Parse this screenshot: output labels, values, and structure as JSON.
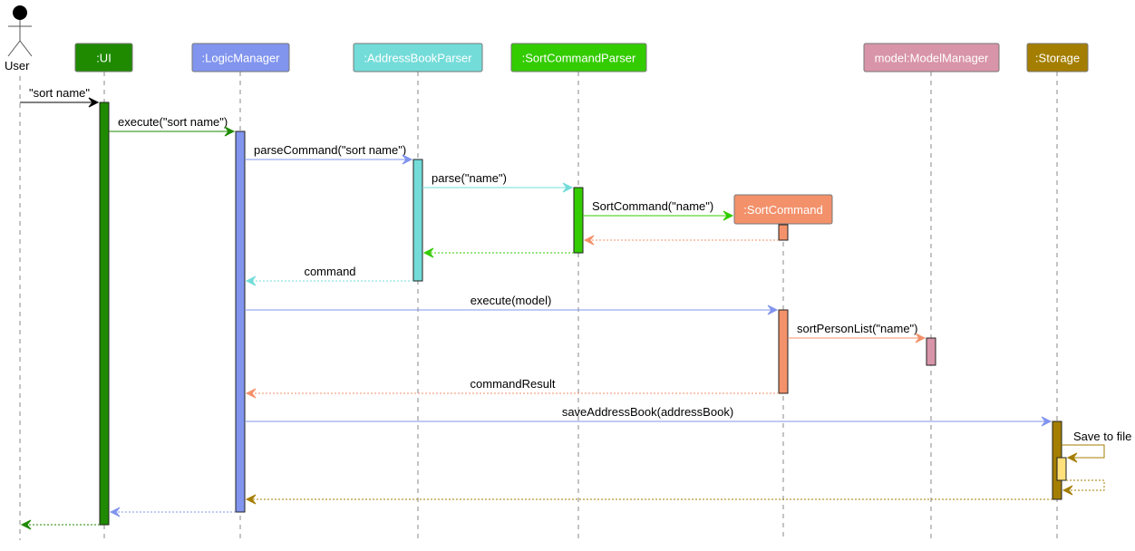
{
  "diagram": {
    "type": "sequence",
    "actor": {
      "label": "User"
    },
    "participants": [
      {
        "id": "ui",
        "label": ":UI",
        "color": "#1f8a00",
        "text_color": "#ffffff"
      },
      {
        "id": "logic",
        "label": ":LogicManager",
        "color": "#8194ee",
        "text_color": "#ffffff"
      },
      {
        "id": "abp",
        "label": ":AddressBookParser",
        "color": "#73dcd9",
        "text_color": "#ffffff"
      },
      {
        "id": "scp",
        "label": ":SortCommandParser",
        "color": "#33cc00",
        "text_color": "#ffffff"
      },
      {
        "id": "sc",
        "label": ":SortCommand",
        "color": "#f3916b",
        "text_color": "#ffffff"
      },
      {
        "id": "mm",
        "label": "model:ModelManager",
        "color": "#d894a8",
        "text_color": "#ffffff"
      },
      {
        "id": "storage",
        "label": ":Storage",
        "color": "#a47e00",
        "text_color": "#ffffff"
      }
    ],
    "messages": [
      {
        "from": "user",
        "to": "ui",
        "label": "\"sort name\"",
        "kind": "call",
        "color": "#000000"
      },
      {
        "from": "ui",
        "to": "logic",
        "label": "execute(\"sort name\")",
        "kind": "call",
        "color": "#1f8a00"
      },
      {
        "from": "logic",
        "to": "abp",
        "label": "parseCommand(\"sort name\")",
        "kind": "call",
        "color": "#8194ee"
      },
      {
        "from": "abp",
        "to": "scp",
        "label": "parse(\"name\")",
        "kind": "call",
        "color": "#73dcd9"
      },
      {
        "from": "scp",
        "to": "sc",
        "label": "SortCommand(\"name\")",
        "kind": "create",
        "color": "#33cc00"
      },
      {
        "from": "sc",
        "to": "scp",
        "label": "",
        "kind": "return",
        "color": "#f3916b"
      },
      {
        "from": "scp",
        "to": "abp",
        "label": "",
        "kind": "return",
        "color": "#33cc00"
      },
      {
        "from": "abp",
        "to": "logic",
        "label": "command",
        "kind": "return",
        "color": "#73dcd9"
      },
      {
        "from": "logic",
        "to": "sc",
        "label": "execute(model)",
        "kind": "call",
        "color": "#8194ee"
      },
      {
        "from": "sc",
        "to": "mm",
        "label": "sortPersonList(\"name\")",
        "kind": "call",
        "color": "#f3916b"
      },
      {
        "from": "sc",
        "to": "logic",
        "label": "commandResult",
        "kind": "return",
        "color": "#f3916b"
      },
      {
        "from": "logic",
        "to": "storage",
        "label": "saveAddressBook(addressBook)",
        "kind": "call",
        "color": "#8194ee"
      },
      {
        "from": "storage",
        "to": "storage",
        "label": "Save to file",
        "kind": "self",
        "color": "#a47e00"
      },
      {
        "from": "storage",
        "to": "storage",
        "label": "",
        "kind": "self-return",
        "color": "#a47e00"
      },
      {
        "from": "storage",
        "to": "logic",
        "label": "",
        "kind": "return",
        "color": "#a47e00"
      },
      {
        "from": "logic",
        "to": "ui",
        "label": "",
        "kind": "return",
        "color": "#8194ee"
      },
      {
        "from": "ui",
        "to": "user",
        "label": "",
        "kind": "return",
        "color": "#1f8a00"
      }
    ],
    "self_activation_color": "#ffe07a"
  }
}
